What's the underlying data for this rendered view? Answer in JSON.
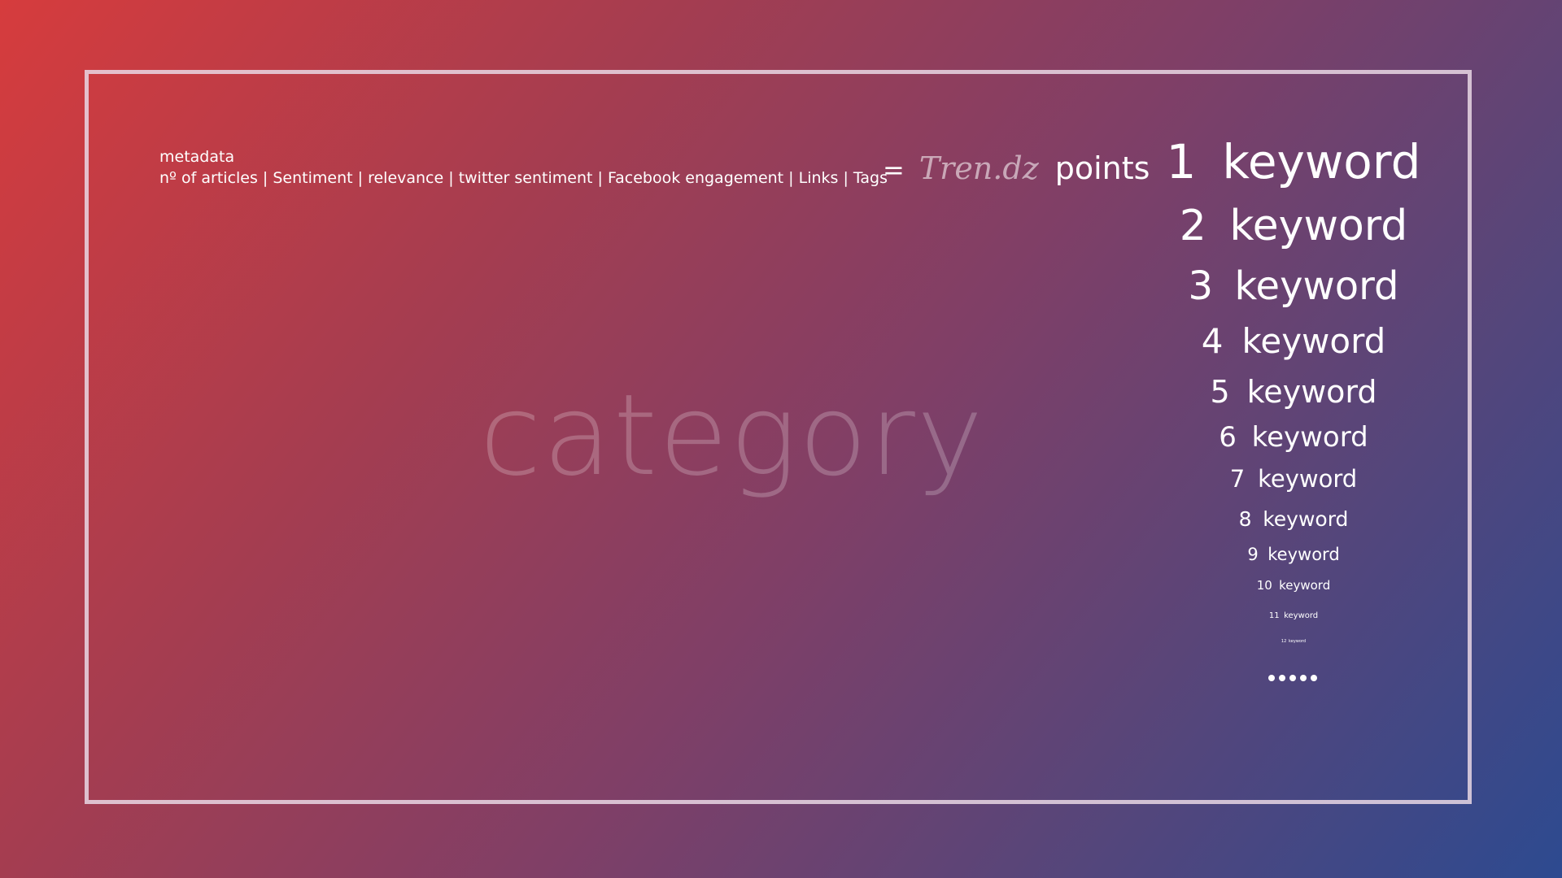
{
  "metadata": {
    "title": "metadata",
    "factors": [
      "nº of articles",
      "Sentiment",
      "relevance",
      "twitter sentiment",
      "Facebook engagement",
      "Links",
      "Tags"
    ],
    "separator": " | "
  },
  "equation": {
    "equals": "=",
    "brand": "Tren.dz",
    "result": "points"
  },
  "category": "category",
  "keywords": [
    {
      "rank": "1",
      "label": "keyword"
    },
    {
      "rank": "2",
      "label": "keyword"
    },
    {
      "rank": "3",
      "label": "keyword"
    },
    {
      "rank": "4",
      "label": "keyword"
    },
    {
      "rank": "5",
      "label": "keyword"
    },
    {
      "rank": "6",
      "label": "keyword"
    },
    {
      "rank": "7",
      "label": "keyword"
    },
    {
      "rank": "8",
      "label": "keyword"
    },
    {
      "rank": "9",
      "label": "keyword"
    },
    {
      "rank": "10",
      "label": "keyword"
    },
    {
      "rank": "11",
      "label": "keyword"
    },
    {
      "rank": "12",
      "label": "keyword"
    }
  ],
  "more_indicator_count": 5,
  "colors": {
    "gradient_start": "#d63c3d",
    "gradient_end": "#2d4a90",
    "frame": "#e9d7e4"
  }
}
